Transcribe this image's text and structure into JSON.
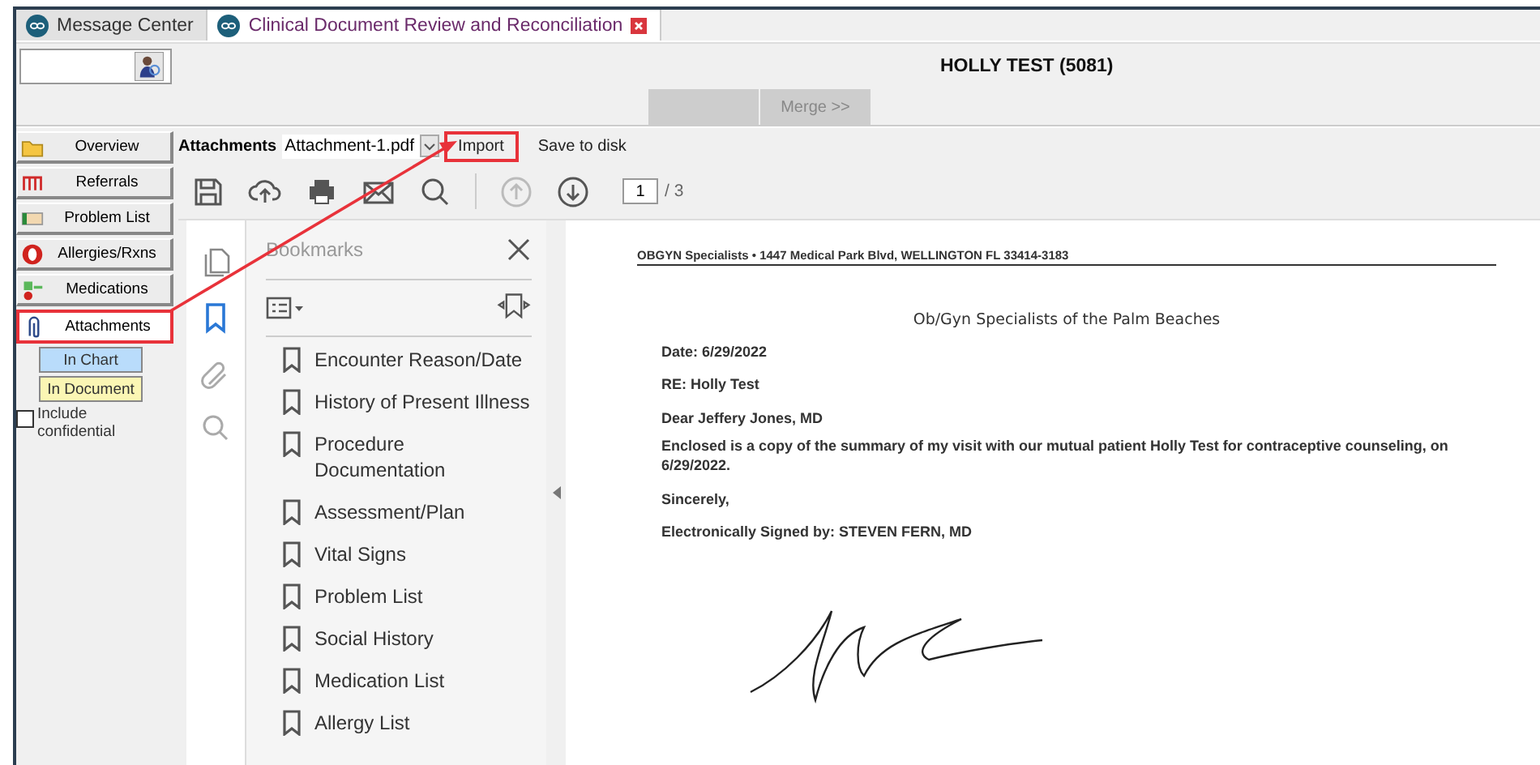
{
  "tabs": [
    {
      "label": "Message Center",
      "selected": false,
      "closable": false
    },
    {
      "label": "Clinical Document Review and Reconciliation",
      "selected": true,
      "closable": true
    }
  ],
  "patient": "HOLLY TEST (5081)",
  "merge_buttons": [
    {
      "disabled": true
    },
    {
      "label": "Merge >>",
      "disabled": true
    }
  ],
  "sidebar": {
    "items": [
      {
        "label": "Overview",
        "selected": false,
        "highlighted": false
      },
      {
        "label": "Referrals",
        "selected": false,
        "highlighted": false
      },
      {
        "label": "Problem List",
        "selected": false,
        "highlighted": false
      },
      {
        "label": "Allergies/Rxns",
        "selected": false,
        "highlighted": false
      },
      {
        "label": "Medications",
        "selected": false,
        "highlighted": false
      },
      {
        "label": "Attachments",
        "selected": true,
        "highlighted": true
      }
    ],
    "filters": [
      {
        "label": "In Chart",
        "color": "#b9dcfb"
      },
      {
        "label": "In Document",
        "color": "#fbf6b4"
      }
    ],
    "include_confidential": {
      "label": "Include confidential",
      "checked": false
    }
  },
  "attachments": {
    "label": "Attachments",
    "file": "Attachment-1.pdf",
    "actions": [
      {
        "label": "Import",
        "highlighted": true
      },
      {
        "label": "Save to disk",
        "highlighted": false
      }
    ]
  },
  "viewer": {
    "page": "1",
    "page_total": "/ 3",
    "up_disabled": true,
    "bookmarks": {
      "title": "Bookmarks",
      "items": [
        "Encounter Reason/Date",
        "History of Present Illness",
        "Procedure Documentation",
        "Assessment/Plan",
        "Vital Signs",
        "Problem List",
        "Social History",
        "Medication List",
        "Allergy List"
      ]
    },
    "document": {
      "letterhead": "OBGYN Specialists • 1447 Medical Park Blvd, WELLINGTON FL 33414-3183",
      "heading": "Ob/Gyn Specialists of the Palm Beaches",
      "date": "Date: 6/29/2022",
      "re": "RE: Holly Test",
      "salutation": "Dear Jeffery Jones, MD",
      "body": "Enclosed is a copy of the summary of my visit with our mutual patient Holly Test for contraceptive counseling, on 6/29/2022.",
      "closing": "Sincerely,",
      "signed": "Electronically Signed by: STEVEN FERN, MD"
    }
  }
}
